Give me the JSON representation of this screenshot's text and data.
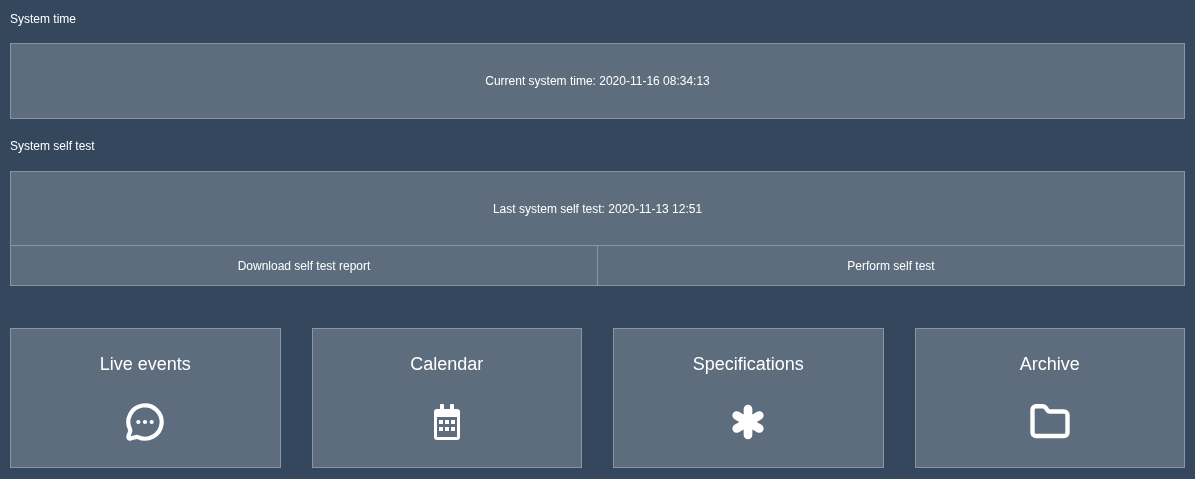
{
  "system_time": {
    "heading": "System time",
    "text": "Current system time: 2020-11-16 08:34:13"
  },
  "self_test": {
    "heading": "System self test",
    "text": "Last system self test: 2020-11-13 12:51",
    "buttons": [
      "Download self test report",
      "Perform self test"
    ]
  },
  "tiles": [
    {
      "label": "Live events",
      "kind": "chat"
    },
    {
      "label": "Calendar",
      "kind": "calendar"
    },
    {
      "label": "Specifications",
      "kind": "asterisk"
    },
    {
      "label": "Archive",
      "kind": "folder"
    }
  ]
}
